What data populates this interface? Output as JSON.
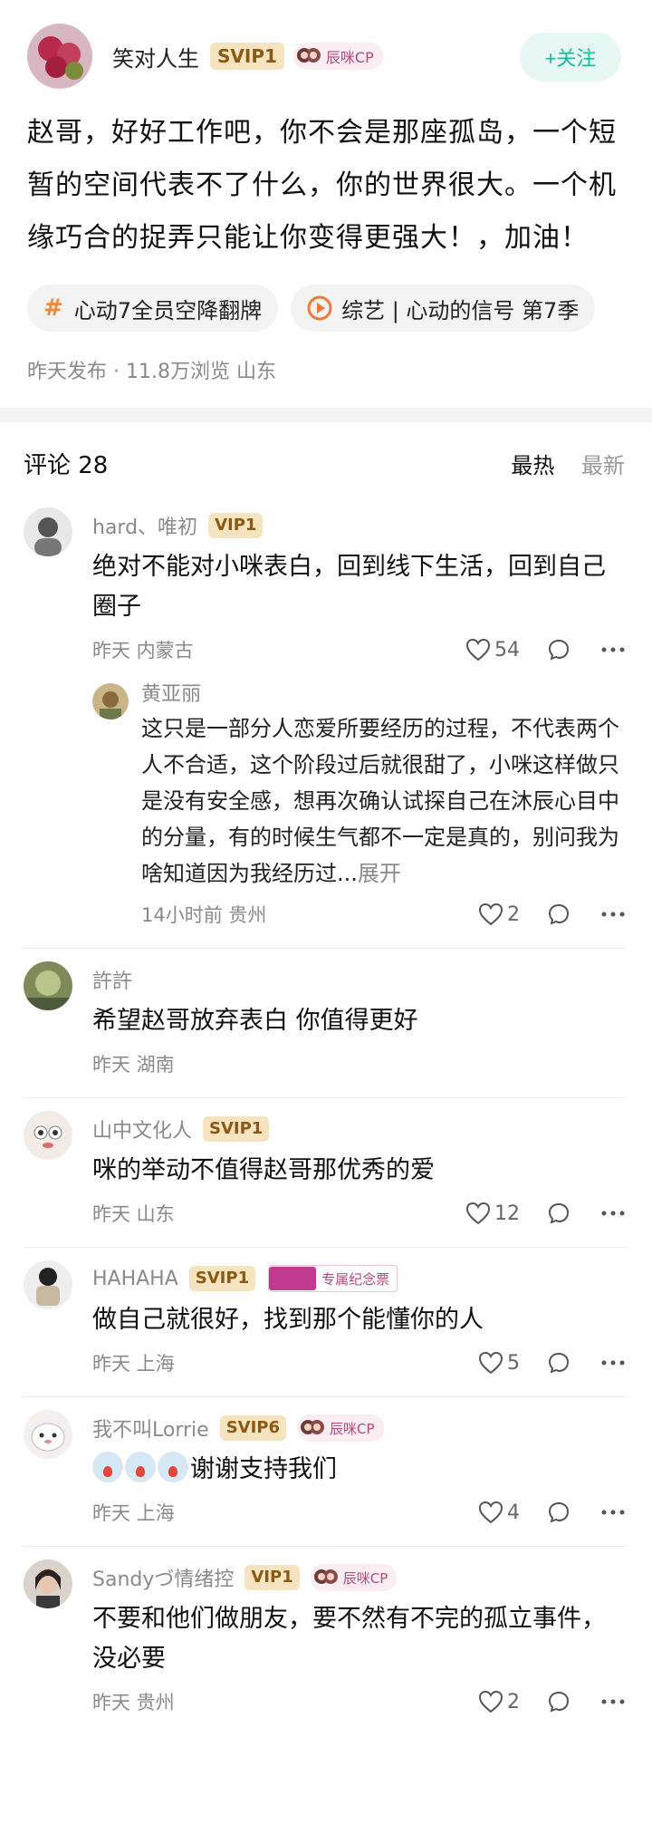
{
  "post": {
    "author": "笑对人生",
    "vip": "SVIP1",
    "cp_badge": "辰咪CP",
    "follow_label": "+关注",
    "text": "赵哥，好好工作吧，你不会是那座孤岛，一个短暂的空间代表不了什么，你的世界很大。一个机缘巧合的捉弄只能让你变得更强大！，加油！",
    "topics": [
      {
        "icon": "hash-icon",
        "label": "心动7全员空降翻牌"
      },
      {
        "icon": "play-icon",
        "label": "综艺 | 心动的信号 第7季"
      }
    ],
    "meta": "昨天发布 · 11.8万浏览  山东"
  },
  "comments_header": {
    "title": "评论 28",
    "sort_hot": "最热",
    "sort_new": "最新"
  },
  "comments": [
    {
      "user": "hard、唯初",
      "vip": "VIP1",
      "cp": "",
      "ticket": "",
      "text": "绝对不能对小咪表白，回到线下生活，回到自己圈子",
      "meta": "昨天  内蒙古",
      "likes": "54",
      "reply": {
        "user": "黄亚丽",
        "text": "这只是一部分人恋爱所要经历的过程，不代表两个人不合适，这个阶段过后就很甜了，小咪这样做只是没有安全感，想再次确认试探自己在沐辰心目中的分量，有的时候生气都不一定是真的，别问我为啥知道因为我经历过...",
        "expand": "展开",
        "meta": "14小时前  贵州",
        "likes": "2"
      }
    },
    {
      "user": "許許",
      "vip": "",
      "cp": "",
      "ticket": "",
      "text": "希望赵哥放弃表白 你值得更好",
      "meta": "昨天  湖南",
      "likes": ""
    },
    {
      "user": "山中文化人",
      "vip": "SVIP1",
      "cp": "",
      "ticket": "",
      "text": "咪的举动不值得赵哥那优秀的爱",
      "meta": "昨天  山东",
      "likes": "12"
    },
    {
      "user": "HAHAHA",
      "vip": "SVIP1",
      "cp": "",
      "ticket": "专属纪念票",
      "text": "做自己就很好，找到那个能懂你的人",
      "meta": "昨天  上海",
      "likes": "5"
    },
    {
      "user": "我不叫Lorrie",
      "vip": "SVIP6",
      "cp": "辰咪CP",
      "ticket": "",
      "text": "谢谢支持我们",
      "meta": "昨天  上海",
      "likes": "4"
    },
    {
      "user": "Sandyづ情绪控",
      "vip": "VIP1",
      "cp": "辰咪CP",
      "ticket": "",
      "text": "不要和他们做朋友，要不然有不完的孤立事件，没必要",
      "meta": "昨天  贵州",
      "likes": "2"
    }
  ],
  "colors": {
    "accent": "#1fb89a",
    "vip_bg": "#f6e3c0",
    "vip_text": "#8a5a14",
    "topic_hash": "#f08a3a"
  }
}
